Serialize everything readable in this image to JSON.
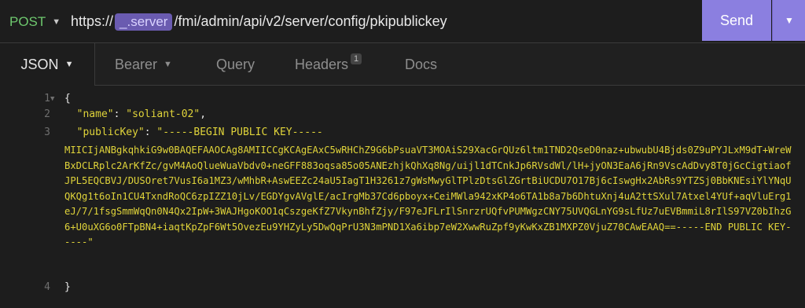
{
  "request": {
    "method": "POST",
    "url_prefix": "https://",
    "env_var": "_.server",
    "url_path": "/fmi/admin/api/v2/server/config/pkipublickey",
    "send_label": "Send"
  },
  "tabs": [
    {
      "label": "JSON",
      "active": true
    },
    {
      "label": "Bearer"
    },
    {
      "label": "Query"
    },
    {
      "label": "Headers",
      "badge": "1"
    },
    {
      "label": "Docs"
    }
  ],
  "editor": {
    "line_numbers": [
      "1",
      "2",
      "3",
      "4"
    ],
    "open_brace": "{",
    "close_brace": "}",
    "name_key": "\"name\"",
    "name_value": "\"soliant-02\"",
    "publickey_key": "\"publicKey\"",
    "publickey_value_start": "\"-----BEGIN PUBLIC KEY-----",
    "publickey_body": "MIICIjANBgkqhkiG9w0BAQEFAAOCAg8AMIICCgKCAgEAxC5wRHChZ9G6bPsuaVT3MOAiS29XacGrQUz6ltm1TND2QseD0naz+ubwubU4Bjds0Z9uPYJLxM9dT+WreWBxDCLRplc2ArKfZc/gvM4AoQlueWuaVbdv0+neGFF883oqsa85o05ANEzhjkQhXq8Ng/uijl1dTCnkJp6RVsdWl/lH+jyON3EaA6jRn9VscAdDvy8T0jGcCigtiaofJPL5EQCBVJ/DUSOret7VusI6a1MZ3/wMhbR+AswEEZc24aU5IagT1H3261z7gWsMwyGlTPlzDtsGlZGrtBiUCDU7O17Bj6cIswgHx2AbRs9YTZSj0BbKNEsiYlYNqUQKQg1t6oIn1CU4TxndRoQC6zpIZZ10jLv/EGDYgvAVglE/acIrgMb37Cd6pboyx+CeiMWla942xKP4o6TA1b8a7b6DhtuXnj4uA2ttSXul7Atxel4YUf+aqVluErg1eJ/7/1fsgSmmWqQn0N4Qx2IpW+3WAJHgoKOO1qCszgeKfZ7VkynBhfZjy/F97eJFLrIlSnrzrUQfvPUMWgzCNY75UVQGLnYG9sLfUz7uEVBmmiL8rIlS97VZ0bIhzG6+U0uXG6o0FTpBN4+iaqtKpZpF6Wt5OvezEu9YHZyLy5DwQqPrU3N3mPND1Xa6ibp7eW2XwwRuZpf9yKwKxZB1MXPZ0VjuZ70CAwEAAQ==",
    "publickey_value_end": "-----END PUBLIC KEY-----\""
  }
}
